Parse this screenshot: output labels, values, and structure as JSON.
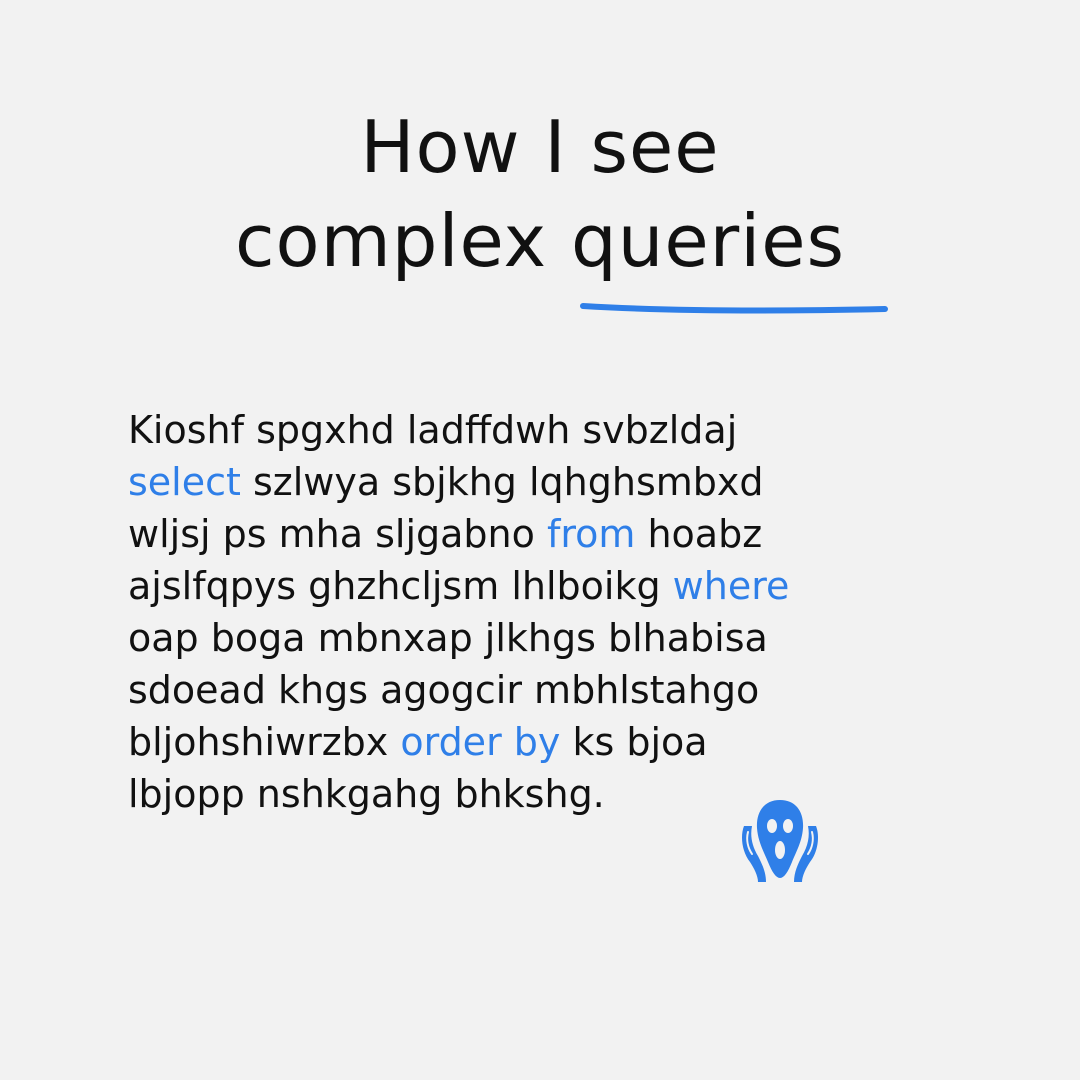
{
  "title": {
    "line1": "How I see",
    "line2_plain": "complex ",
    "line2_highlight": "queries"
  },
  "paragraph": {
    "r1": "Kioshf spgxhd ladffdwh svbzldaj",
    "r2_kw": "select",
    "r2_rest": " szlwya sbjkhg lqhghsmbxd",
    "r3_pre": "wljsj ps mha sljgabno ",
    "r3_kw": "from",
    "r3_post": " hoabz",
    "r4_pre": "ajslfqpys ghzhcljsm lhlboikg ",
    "r4_kw": "where",
    "r5": "oap boga mbnxap jlkhgs blhabisa",
    "r6": "sdoead khgs agogcir mbhlstahgo",
    "r7_pre": "bljohshiwrzbx ",
    "r7_kw": "order by",
    "r7_post": " ks bjoa",
    "r8": "lbjopp nshkgahg bhkshg."
  },
  "icon": "screaming-face-icon",
  "colors": {
    "background": "#f2f2f2",
    "text": "#111111",
    "accent": "#2f7fe8"
  }
}
